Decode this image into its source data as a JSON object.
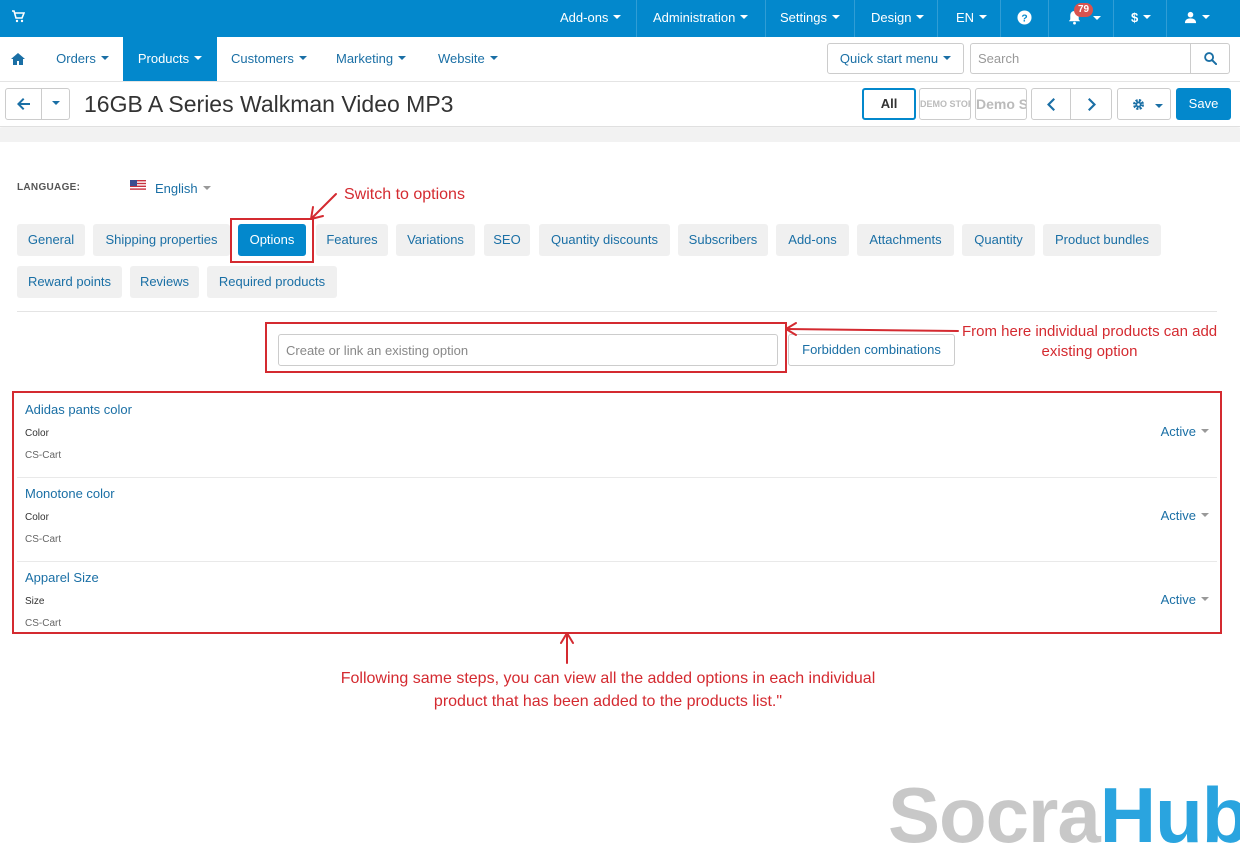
{
  "topbar": {
    "cart_icon": "cart-icon",
    "addons": "Add-ons",
    "administration": "Administration",
    "settings": "Settings",
    "design": "Design",
    "language": "EN",
    "help_icon": "question-circle-icon",
    "notifications_icon": "bell-icon",
    "notifications_count": "79",
    "currency": "$",
    "user_icon": "user-icon",
    "background_color": "#0388cc"
  },
  "navbar": {
    "home_icon": "home-icon",
    "orders": "Orders",
    "products": "Products",
    "customers": "Customers",
    "marketing": "Marketing",
    "website": "Website",
    "quick_start": "Quick start menu",
    "search_placeholder": "Search",
    "search_icon": "search-icon"
  },
  "titlebar": {
    "title": "16GB A Series Walkman Video MP3",
    "vendor_all": "All",
    "vendor_demo_small": "DEMO STORE",
    "vendor_demo_large": "Demo Store",
    "save": "Save",
    "accent_color": "#0388cc"
  },
  "language": {
    "label": "LANGUAGE:",
    "value": "English"
  },
  "tabs": [
    "General",
    "Shipping properties",
    "Options",
    "Features",
    "Variations",
    "SEO",
    "Quantity discounts",
    "Subscribers",
    "Add-ons",
    "Attachments",
    "Quantity",
    "Product bundles",
    "Reward points",
    "Reviews",
    "Required products"
  ],
  "active_tab": "Options",
  "options_panel": {
    "input_placeholder": "Create or link an existing option",
    "forbidden_button": "Forbidden combinations",
    "items": [
      {
        "name": "Adidas pants color",
        "type": "Color",
        "vendor": "CS-Cart",
        "status": "Active"
      },
      {
        "name": "Monotone color",
        "type": "Color",
        "vendor": "CS-Cart",
        "status": "Active"
      },
      {
        "name": "Apparel Size",
        "type": "Size",
        "vendor": "CS-Cart",
        "status": "Active"
      }
    ]
  },
  "annotations": {
    "switch": "Switch to options",
    "existing_line1": "From here individual products can add",
    "existing_line2": "existing option",
    "following_line1": "Following same steps, you can view all the added options in each individual",
    "following_line2": "product that has been added to the products list.\"",
    "color": "#d42a30"
  },
  "watermark": {
    "part1": "Socra",
    "part2": "Hub",
    "color_gray": "#c8c8c8",
    "color_blue": "#2aa4df"
  }
}
